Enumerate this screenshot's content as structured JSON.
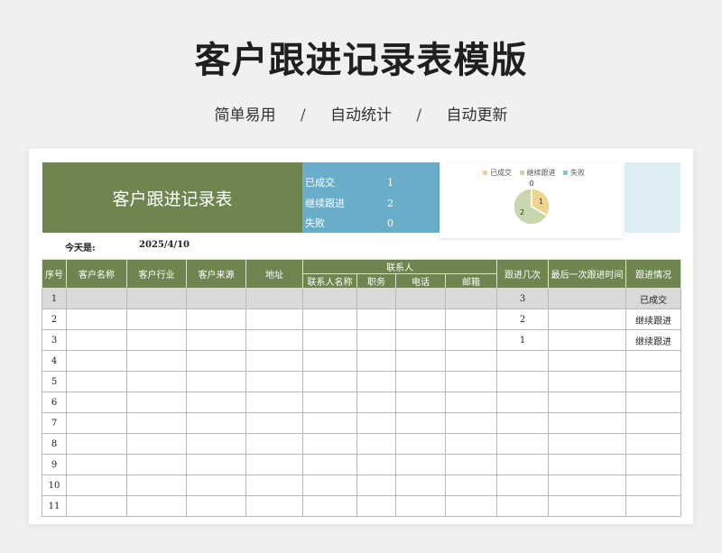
{
  "header": {
    "title": "客户跟进记录表模版",
    "features": [
      "简单易用",
      "自动统计",
      "自动更新"
    ],
    "separator": "/"
  },
  "sheet": {
    "banner_title": "客户跟进记录表",
    "stats": [
      {
        "label": "已成交",
        "value": "1"
      },
      {
        "label": "继续跟进",
        "value": "2"
      },
      {
        "label": "失败",
        "value": "0"
      }
    ],
    "today_label": "今天是:",
    "today_value": "2025/4/10",
    "columns": {
      "index": "序号",
      "name": "客户名称",
      "industry": "客户行业",
      "source": "客户来源",
      "address": "地址",
      "contact_group": "联系人",
      "contact_name": "联系人名称",
      "position": "职务",
      "phone": "电话",
      "email": "邮箱",
      "times": "跟进几次",
      "last_time": "最后一次跟进时间",
      "status": "跟进情况"
    },
    "rows": [
      {
        "index": "1",
        "times": "3",
        "status": "已成交"
      },
      {
        "index": "2",
        "times": "2",
        "status": "继续跟进"
      },
      {
        "index": "3",
        "times": "1",
        "status": "继续跟进"
      },
      {
        "index": "4",
        "times": "",
        "status": ""
      },
      {
        "index": "5",
        "times": "",
        "status": ""
      },
      {
        "index": "6",
        "times": "",
        "status": ""
      },
      {
        "index": "7",
        "times": "",
        "status": ""
      },
      {
        "index": "8",
        "times": "",
        "status": ""
      },
      {
        "index": "9",
        "times": "",
        "status": ""
      },
      {
        "index": "10",
        "times": "",
        "status": ""
      },
      {
        "index": "11",
        "times": "",
        "status": ""
      }
    ]
  },
  "chart_data": {
    "type": "pie",
    "categories": [
      "已成交",
      "继续跟进",
      "失败"
    ],
    "values": [
      1,
      2,
      0
    ],
    "colors": [
      "#eed58f",
      "#c8d7ad",
      "#8bc3cc"
    ]
  },
  "colors": {
    "banner": "#6e8550",
    "stats": "#69adc8",
    "header_row": "#6e8550",
    "shaded_row": "#d9d9d9",
    "pale_box": "#dcedf3"
  }
}
